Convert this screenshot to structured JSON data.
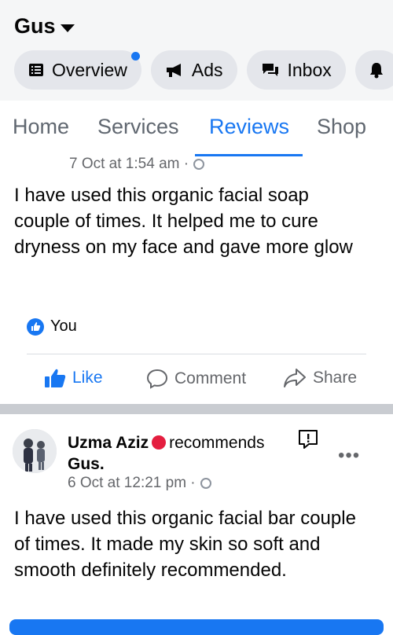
{
  "header": {
    "page_name": "Gus",
    "chips": [
      {
        "label": "Overview",
        "icon": "list-icon",
        "has_dot": true
      },
      {
        "label": "Ads",
        "icon": "megaphone-icon"
      },
      {
        "label": "Inbox",
        "icon": "chat-icon"
      },
      {
        "label": "",
        "icon": "bell-icon"
      }
    ]
  },
  "tabs": [
    {
      "label": "Home"
    },
    {
      "label": "Services"
    },
    {
      "label": "Reviews",
      "active": true
    },
    {
      "label": "Shop"
    }
  ],
  "post1": {
    "timestamp": "7 Oct at 1:54 am ·",
    "text": "I have used this organic facial soap couple of times. It helped me to cure dryness on my face and gave more glow",
    "reaction_text": "You",
    "actions": {
      "like": "Like",
      "comment": "Comment",
      "share": "Share"
    }
  },
  "post2": {
    "author": "Uzma Aziz",
    "verb": "recommends",
    "target": "Gus.",
    "timestamp": "6 Oct at 12:21 pm ·",
    "text": "I have used this organic facial bar couple of times. It made my skin so soft and smooth definitely recommended."
  },
  "colors": {
    "accent": "#1877f2",
    "recommend_badge": "#e41e3f"
  }
}
